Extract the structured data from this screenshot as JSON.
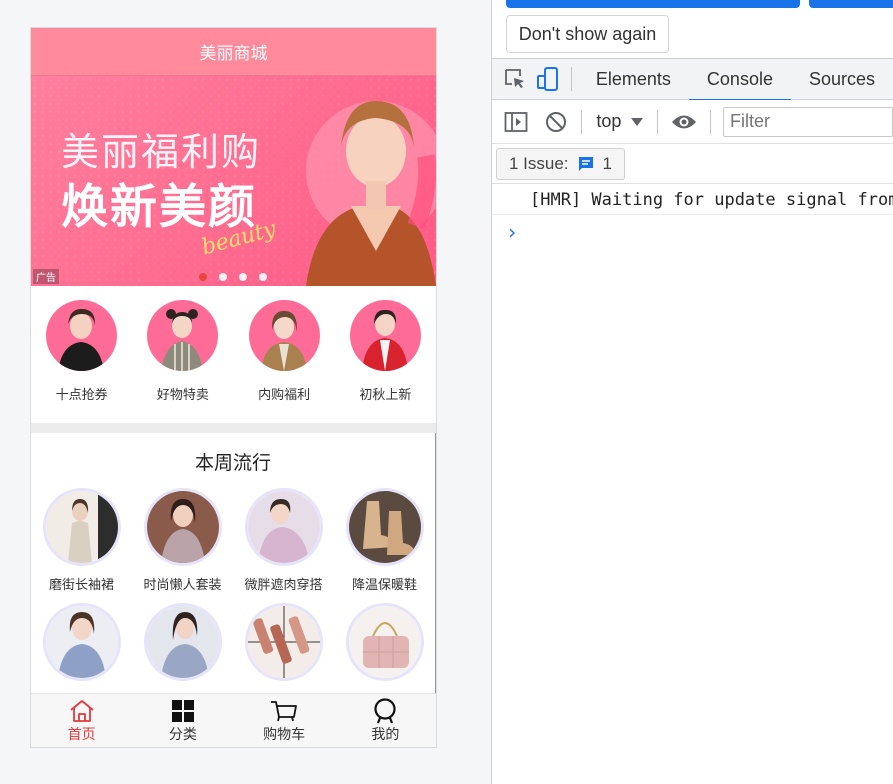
{
  "app": {
    "title": "美丽商城",
    "banner": {
      "headline": "美丽福利购",
      "subheadline": "焕新美颜",
      "script_text": "beauty",
      "ad_tag": "广告",
      "slides": 4,
      "active_slide": 1
    },
    "quick_categories": [
      {
        "label": "十点抢券",
        "icon": "woman-black-top"
      },
      {
        "label": "好物特卖",
        "icon": "woman-striped-dress"
      },
      {
        "label": "内购福利",
        "icon": "woman-coat"
      },
      {
        "label": "初秋上新",
        "icon": "woman-red-jacket"
      }
    ],
    "weekly": {
      "title": "本周流行",
      "items": [
        {
          "label": "磨街长袖裙",
          "color": "#e9e2d6"
        },
        {
          "label": "时尚懒人套装",
          "color": "#b9a3a6"
        },
        {
          "label": "微胖遮肉穿搭",
          "color": "#d7c3d8"
        },
        {
          "label": "降温保暖鞋",
          "color": "#c9a98a"
        },
        {
          "label": "",
          "color": "#8fa0c6"
        },
        {
          "label": "",
          "color": "#9aa7c4"
        },
        {
          "label": "",
          "color": "#c9826f"
        },
        {
          "label": "",
          "color": "#e0b5b3"
        }
      ]
    },
    "tabbar": [
      {
        "label": "首页",
        "icon": "home-icon",
        "active": true
      },
      {
        "label": "分类",
        "icon": "grid-icon",
        "active": false
      },
      {
        "label": "购物车",
        "icon": "cart-icon",
        "active": false
      },
      {
        "label": "我的",
        "icon": "user-icon",
        "active": false
      }
    ],
    "colors": {
      "header": "#ff8a9b",
      "active_tab": "#e4393c",
      "avatar_bg": "#ff6b97"
    }
  },
  "devtools": {
    "dont_show_again": "Don't show again",
    "tabs": [
      "Elements",
      "Console",
      "Sources"
    ],
    "active_tab": "Console",
    "context": "top",
    "filter_placeholder": "Filter",
    "issues_label": "1 Issue:",
    "issues_count": "1",
    "log": "[HMR] Waiting for update signal from WDS...",
    "prompt": "›"
  }
}
